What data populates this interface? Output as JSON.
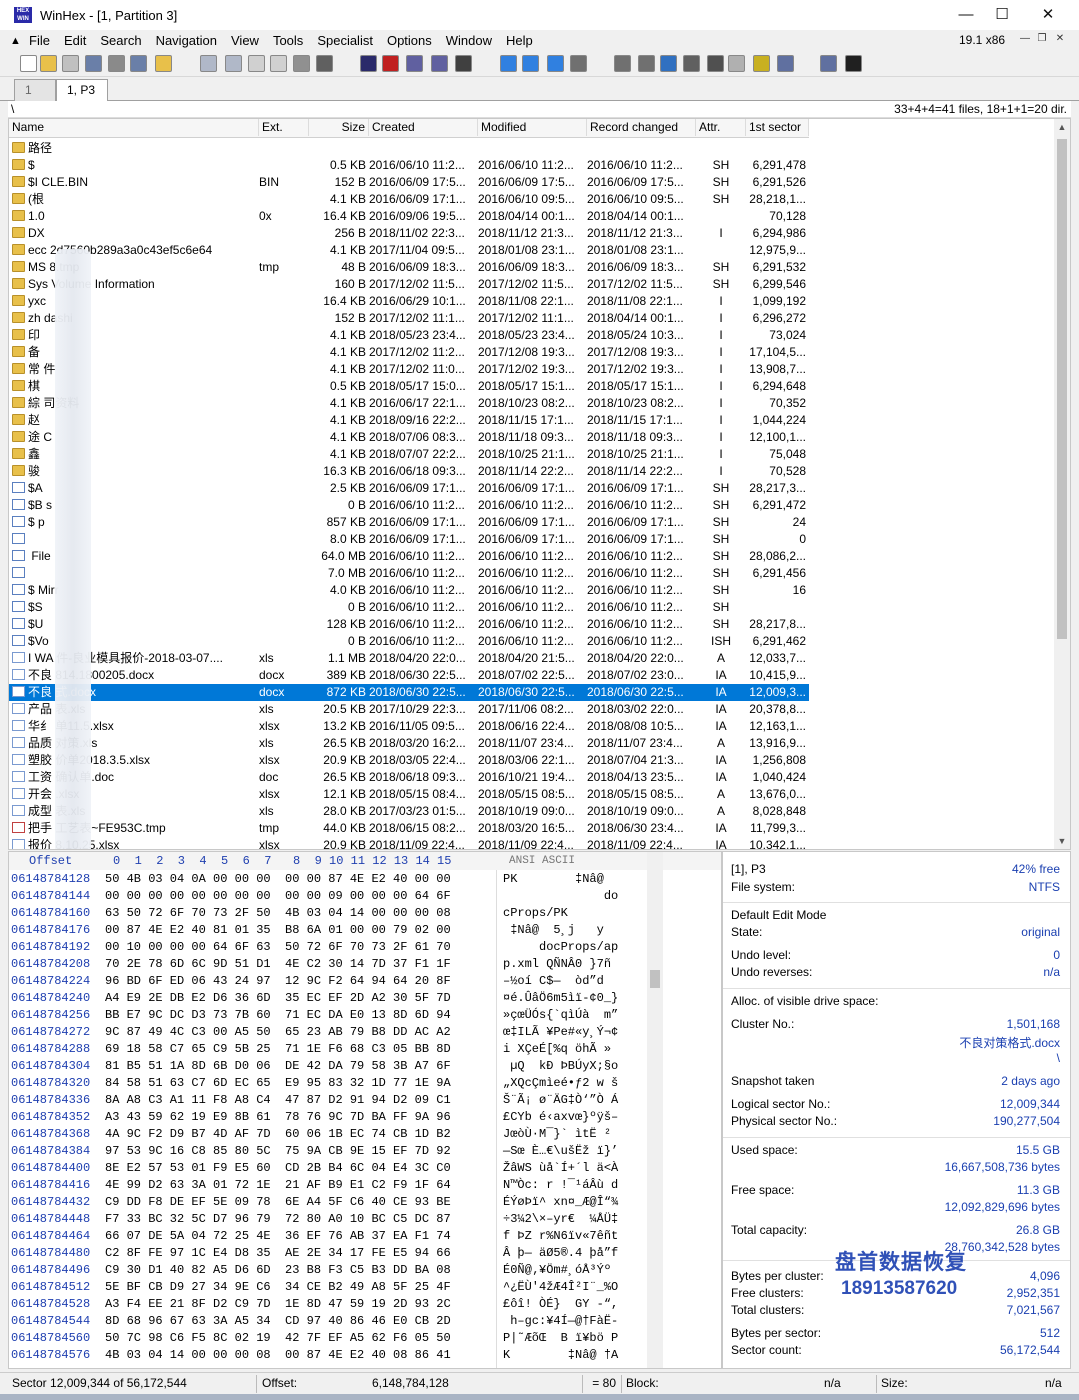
{
  "window": {
    "title": "WinHex - [1, Partition 3]",
    "version": "19.1 x86"
  },
  "menu": [
    "File",
    "Edit",
    "Search",
    "Navigation",
    "View",
    "Tools",
    "Specialist",
    "Options",
    "Window",
    "Help"
  ],
  "tabs": [
    "1",
    "1, P3"
  ],
  "path": {
    "current": "\\",
    "summary": "33+4+4=41 files, 18+1+1=20 dir."
  },
  "columns": [
    "Name",
    "Ext.",
    "Size",
    "Created",
    "Modified",
    "Record changed",
    "Attr.",
    "1st sector"
  ],
  "files": [
    {
      "name": "路径",
      "ext": "",
      "size": "",
      "created": "",
      "modified": "",
      "changed": "",
      "attr": "",
      "sector": "",
      "icon": "folder"
    },
    {
      "name": "$",
      "ext": "",
      "size": "0.5 KB",
      "created": "2016/06/10  11:2...",
      "modified": "2016/06/10  11:2...",
      "changed": "2016/06/10  11:2...",
      "attr": "SH",
      "sector": "6,291,478",
      "icon": "folder"
    },
    {
      "name": "$I     CLE.BIN",
      "ext": "BIN",
      "size": "152 B",
      "created": "2016/06/09  17:5...",
      "modified": "2016/06/09  17:5...",
      "changed": "2016/06/09  17:5...",
      "attr": "SH",
      "sector": "6,291,526",
      "icon": "folder"
    },
    {
      "name": "(根",
      "ext": "",
      "size": "4.1 KB",
      "created": "2016/06/09  17:1...",
      "modified": "2016/06/10  09:5...",
      "changed": "2016/06/10  09:5...",
      "attr": "SH",
      "sector": "28,218,1...",
      "icon": "folder"
    },
    {
      "name": "1.0",
      "ext": "0x",
      "size": "16.4 KB",
      "created": "2016/09/06  19:5...",
      "modified": "2018/04/14  00:1...",
      "changed": "2018/04/14  00:1...",
      "attr": "",
      "sector": "70,128",
      "icon": "folder"
    },
    {
      "name": "DX",
      "ext": "",
      "size": "256 B",
      "created": "2018/11/02  22:3...",
      "modified": "2018/11/12  21:3...",
      "changed": "2018/11/12  21:3...",
      "attr": "I",
      "sector": "6,294,986",
      "icon": "folder"
    },
    {
      "name": "ecc     2d7560b289a3a0c43ef5c6e64",
      "ext": "",
      "size": "4.1 KB",
      "created": "2017/11/04  09:5...",
      "modified": "2018/01/08  23:1...",
      "changed": "2018/01/08  23:1...",
      "attr": "",
      "sector": "12,975,9...",
      "icon": "folder"
    },
    {
      "name": "MS      8.tmp",
      "ext": "tmp",
      "size": "48 B",
      "created": "2016/06/09  18:3...",
      "modified": "2016/06/09  18:3...",
      "changed": "2016/06/09  18:3...",
      "attr": "SH",
      "sector": "6,291,532",
      "icon": "folder"
    },
    {
      "name": "Sys     Volume Information",
      "ext": "",
      "size": "160 B",
      "created": "2017/12/02  11:5...",
      "modified": "2017/12/02  11:5...",
      "changed": "2017/12/02  11:5...",
      "attr": "SH",
      "sector": "6,299,546",
      "icon": "folder"
    },
    {
      "name": "yxc",
      "ext": "",
      "size": "16.4 KB",
      "created": "2016/06/29  10:1...",
      "modified": "2018/11/08  22:1...",
      "changed": "2018/11/08  22:1...",
      "attr": "I",
      "sector": "1,099,192",
      "icon": "folder"
    },
    {
      "name": "zh      dashi",
      "ext": "",
      "size": "152 B",
      "created": "2017/12/02  11:1...",
      "modified": "2017/12/02  11:1...",
      "changed": "2018/04/14  00:1...",
      "attr": "I",
      "sector": "6,296,272",
      "icon": "folder"
    },
    {
      "name": "印",
      "ext": "",
      "size": "4.1 KB",
      "created": "2018/05/23  23:4...",
      "modified": "2018/05/23  23:4...",
      "changed": "2018/05/24  10:3...",
      "attr": "I",
      "sector": "73,024",
      "icon": "folder"
    },
    {
      "name": "备",
      "ext": "",
      "size": "4.1 KB",
      "created": "2017/12/02  11:2...",
      "modified": "2017/12/08  19:3...",
      "changed": "2017/12/08  19:3...",
      "attr": "I",
      "sector": "17,104,5...",
      "icon": "folder"
    },
    {
      "name": "常      件",
      "ext": "",
      "size": "4.1 KB",
      "created": "2017/12/02  11:0...",
      "modified": "2017/12/02  19:3...",
      "changed": "2017/12/02  19:3...",
      "attr": "I",
      "sector": "13,908,7...",
      "icon": "folder"
    },
    {
      "name": "棋",
      "ext": "",
      "size": "0.5 KB",
      "created": "2018/05/17  15:0...",
      "modified": "2018/05/17  15:1...",
      "changed": "2018/05/17  15:1...",
      "attr": "I",
      "sector": "6,294,648",
      "icon": "folder"
    },
    {
      "name": "綜      司资料",
      "ext": "",
      "size": "4.1 KB",
      "created": "2016/06/17  22:1...",
      "modified": "2018/10/23  08:2...",
      "changed": "2018/10/23  08:2...",
      "attr": "I",
      "sector": "70,352",
      "icon": "folder"
    },
    {
      "name": "赵",
      "ext": "",
      "size": "4.1 KB",
      "created": "2018/09/16  22:2...",
      "modified": "2018/11/15  17:1...",
      "changed": "2018/11/15  17:1...",
      "attr": "I",
      "sector": "1,044,224",
      "icon": "folder"
    },
    {
      "name": "途      C",
      "ext": "",
      "size": "4.1 KB",
      "created": "2018/07/06  08:3...",
      "modified": "2018/11/18  09:3...",
      "changed": "2018/11/18  09:3...",
      "attr": "I",
      "sector": "12,100,1...",
      "icon": "folder"
    },
    {
      "name": "鑫",
      "ext": "",
      "size": "4.1 KB",
      "created": "2018/07/07  22:2...",
      "modified": "2018/10/25  21:1...",
      "changed": "2018/10/25  21:1...",
      "attr": "I",
      "sector": "75,048",
      "icon": "folder"
    },
    {
      "name": "骏",
      "ext": "",
      "size": "16.3 KB",
      "created": "2016/06/18  09:3...",
      "modified": "2018/11/14  22:2...",
      "changed": "2018/11/14  22:2...",
      "attr": "I",
      "sector": "70,528",
      "icon": "folder"
    },
    {
      "name": "$A",
      "ext": "",
      "size": "2.5 KB",
      "created": "2016/06/09  17:1...",
      "modified": "2016/06/09  17:1...",
      "changed": "2016/06/09  17:1...",
      "attr": "SH",
      "sector": "28,217,3...",
      "icon": "sys"
    },
    {
      "name": "$B      s",
      "ext": "",
      "size": "0 B",
      "created": "2016/06/10  11:2...",
      "modified": "2016/06/10  11:2...",
      "changed": "2016/06/10  11:2...",
      "attr": "SH",
      "sector": "6,291,472",
      "icon": "sys"
    },
    {
      "name": "$       p",
      "ext": "",
      "size": "857 KB",
      "created": "2016/06/09  17:1...",
      "modified": "2016/06/09  17:1...",
      "changed": "2016/06/09  17:1...",
      "attr": "SH",
      "sector": "24",
      "icon": "sys"
    },
    {
      "name": "",
      "ext": "",
      "size": "8.0 KB",
      "created": "2016/06/09  17:1...",
      "modified": "2016/06/09  17:1...",
      "changed": "2016/06/09  17:1...",
      "attr": "SH",
      "sector": "0",
      "icon": "sys"
    },
    {
      "name": "      File",
      "ext": "",
      "size": "64.0 MB",
      "created": "2016/06/10  11:2...",
      "modified": "2016/06/10  11:2...",
      "changed": "2016/06/10  11:2...",
      "attr": "SH",
      "sector": "28,086,2...",
      "icon": "sys"
    },
    {
      "name": "",
      "ext": "",
      "size": "7.0 MB",
      "created": "2016/06/10  11:2...",
      "modified": "2016/06/10  11:2...",
      "changed": "2016/06/10  11:2...",
      "attr": "SH",
      "sector": "6,291,456",
      "icon": "sys"
    },
    {
      "name": "$       Mirr",
      "ext": "",
      "size": "4.0 KB",
      "created": "2016/06/10  11:2...",
      "modified": "2016/06/10  11:2...",
      "changed": "2016/06/10  11:2...",
      "attr": "SH",
      "sector": "16",
      "icon": "sys"
    },
    {
      "name": "$S",
      "ext": "",
      "size": "0 B",
      "created": "2016/06/10  11:2...",
      "modified": "2016/06/10  11:2...",
      "changed": "2016/06/10  11:2...",
      "attr": "SH",
      "sector": "",
      "icon": "sys"
    },
    {
      "name": "$U",
      "ext": "",
      "size": "128 KB",
      "created": "2016/06/10  11:2...",
      "modified": "2016/06/10  11:2...",
      "changed": "2016/06/10  11:2...",
      "attr": "SH",
      "sector": "28,217,8...",
      "icon": "sys"
    },
    {
      "name": "$Vo",
      "ext": "",
      "size": "0 B",
      "created": "2016/06/10  11:2...",
      "modified": "2016/06/10  11:2...",
      "changed": "2016/06/10  11:2...",
      "attr": "ISH",
      "sector": "6,291,462",
      "icon": "sys"
    },
    {
      "name": "I WA      件-良业模具报价-2018-03-07....",
      "ext": "xls",
      "size": "1.1 MB",
      "created": "2018/04/20  22:0...",
      "modified": "2018/04/20  21:5...",
      "changed": "2018/04/20  22:0...",
      "attr": "A",
      "sector": "12,033,7...",
      "icon": "doc"
    },
    {
      "name": "不良      814.1800205.docx",
      "ext": "docx",
      "size": "389 KB",
      "created": "2018/06/30  22:5...",
      "modified": "2018/07/02  22:5...",
      "changed": "2018/07/02  23:0...",
      "attr": "IA",
      "sector": "10,415,9...",
      "icon": "doc"
    },
    {
      "name": "不良      式.docx",
      "ext": "docx",
      "size": "872 KB",
      "created": "2018/06/30  22:5...",
      "modified": "2018/06/30  22:5...",
      "changed": "2018/06/30  22:5...",
      "attr": "IA",
      "sector": "12,009,3...",
      "icon": "doc",
      "selected": true
    },
    {
      "name": "产品      表.xls",
      "ext": "xls",
      "size": "20.5 KB",
      "created": "2017/10/29  22:3...",
      "modified": "2017/11/06  08:2...",
      "changed": "2018/03/02  22:0...",
      "attr": "IA",
      "sector": "20,378,8...",
      "icon": "doc"
    },
    {
      "name": "华纟      单11.5.xlsx",
      "ext": "xlsx",
      "size": "13.2 KB",
      "created": "2016/11/05  09:5...",
      "modified": "2018/06/16  22:4...",
      "changed": "2018/08/08  10:5...",
      "attr": "IA",
      "sector": "12,163,1...",
      "icon": "doc"
    },
    {
      "name": "品质      对策.xls",
      "ext": "xls",
      "size": "26.5 KB",
      "created": "2018/03/20  16:2...",
      "modified": "2018/11/07  23:4...",
      "changed": "2018/11/07  23:4...",
      "attr": "A",
      "sector": "13,916,9...",
      "icon": "doc"
    },
    {
      "name": "塑胶      价单2018.3.5.xlsx",
      "ext": "xlsx",
      "size": "20.9 KB",
      "created": "2018/03/05  22:4...",
      "modified": "2018/03/06  22:1...",
      "changed": "2018/07/04  21:3...",
      "attr": "IA",
      "sector": "1,256,808",
      "icon": "doc"
    },
    {
      "name": "工资      确认单.doc",
      "ext": "doc",
      "size": "26.5 KB",
      "created": "2018/06/18  09:3...",
      "modified": "2016/10/21  19:4...",
      "changed": "2018/04/13  23:5...",
      "attr": "IA",
      "sector": "1,040,424",
      "icon": "doc"
    },
    {
      "name": "开会      .xlsx",
      "ext": "xlsx",
      "size": "12.1 KB",
      "created": "2018/05/15  08:4...",
      "modified": "2018/05/15  08:5...",
      "changed": "2018/05/15  08:5...",
      "attr": "A",
      "sector": "13,676,0...",
      "icon": "doc"
    },
    {
      "name": "成型      表.xls",
      "ext": "xls",
      "size": "28.0 KB",
      "created": "2017/03/23  01:5...",
      "modified": "2018/10/19  09:0...",
      "changed": "2018/10/19  09:0...",
      "attr": "A",
      "sector": "8,028,848",
      "icon": "doc"
    },
    {
      "name": "把手      工艺表~FE953C.tmp",
      "ext": "tmp",
      "size": "44.0 KB",
      "created": "2018/06/15  08:2...",
      "modified": "2018/03/20  16:5...",
      "changed": "2018/06/30  23:4...",
      "attr": "IA",
      "sector": "11,799,3...",
      "icon": "del"
    },
    {
      "name": "报价      8.10.25.xlsx",
      "ext": "xlsx",
      "size": "20.9 KB",
      "created": "2018/11/09  22:4...",
      "modified": "2018/11/09  22:4...",
      "changed": "2018/11/09  22:4...",
      "attr": "IA",
      "sector": "10,342,1...",
      "icon": "doc"
    }
  ],
  "hex": {
    "header_offset": "Offset",
    "header_cols": "0  1  2  3  4  5  6  7   8  9 10 11 12 13 14 15",
    "header_text": "ANSI ASCII",
    "rows": [
      [
        "06148784128",
        "50 4B 03 04 0A 00 00 00  00 00 87 4E E2 40 00 00",
        "PK        ‡Nâ@  "
      ],
      [
        "06148784144",
        "00 00 00 00 00 00 00 00  00 00 09 00 00 00 64 6F",
        "              do"
      ],
      [
        "06148784160",
        "63 50 72 6F 70 73 2F 50  4B 03 04 14 00 00 00 08",
        "cProps/PK       "
      ],
      [
        "06148784176",
        "00 87 4E E2 40 81 01 35  B8 6A 01 00 00 79 02 00",
        " ‡Nâ@  5¸j   y  "
      ],
      [
        "06148784192",
        "00 10 00 00 00 64 6F 63  50 72 6F 70 73 2F 61 70",
        "     docProps/ap"
      ],
      [
        "06148784208",
        "70 2E 78 6D 6C 9D 51 D1  4E C2 30 14 7D 37 F1 1F",
        "p.xml QÑNÂ0 }7ñ "
      ],
      [
        "06148784224",
        "96 BD 6F ED 06 43 24 97  12 9C F2 64 94 64 20 8F",
        "–½oí C$—  òd”d  "
      ],
      [
        "06148784240",
        "A4 E9 2E DB E2 D6 36 6D  35 EC EF 2D A2 30 5F 7D",
        "¤é.ÛâÖ6m5ìï-¢0_}"
      ],
      [
        "06148784256",
        "BB E7 9C DC D3 73 7B 60  71 EC DA E0 13 8D 6D 94",
        "»çœÜÓs{`qìÚà  m”"
      ],
      [
        "06148784272",
        "9C 87 49 4C C3 00 A5 50  65 23 AB 79 B8 DD AC A2",
        "œ‡ILÃ ¥Pe#«y¸Ý¬¢"
      ],
      [
        "06148784288",
        "69 18 58 C7 65 C9 5B 25  71 1E F6 68 C3 05 BB 8D",
        "i XÇeÉ[%q öhÃ » "
      ],
      [
        "06148784304",
        "81 B5 51 1A 8D 6B D0 06  DE 42 DA 79 58 3B A7 6F",
        " µQ  kÐ ÞBÚyX;§o"
      ],
      [
        "06148784320",
        "84 58 51 63 C7 6D EC 65  E9 95 83 32 1D 77 1E 9A",
        "„XQcÇmìeé•ƒ2 w š"
      ],
      [
        "06148784336",
        "8A A8 C3 A1 11 F8 A8 C4  47 87 D2 91 94 D2 09 C1",
        "Š¨Ã¡ ø¨ÄG‡Ò‘”Ò Á"
      ],
      [
        "06148784352",
        "A3 43 59 62 19 E9 8B 61  78 76 9C 7D BA FF 9A 96",
        "£CYb é‹axvœ}ºÿš–"
      ],
      [
        "06148784368",
        "4A 9C F2 D9 B7 4D AF 7D  60 06 1B EC 74 CB 1D B2",
        "JœòÙ·M¯}` ìtË ²"
      ],
      [
        "06148784384",
        "97 53 9C 16 C8 85 80 5C  75 9A CB 9E 15 EF 7D 92",
        "—Sœ È…€\\ušËž ï}’"
      ],
      [
        "06148784400",
        "8E E2 57 53 01 F9 E5 60  CD 2B B4 6C 04 E4 3C C0",
        "ŽâWS ùå`Í+´l ä<À"
      ],
      [
        "06148784416",
        "4E 99 D2 63 3A 01 72 1E  21 AF B9 E1 C2 F9 1F 64",
        "N™Òc: r !¯¹áÂù d"
      ],
      [
        "06148784432",
        "C9 DD F8 DE EF 5E 09 78  6E A4 5F C6 40 CE 93 BE",
        "ÉÝøÞï^ xn¤_Æ@Î“¾"
      ],
      [
        "06148784448",
        "F7 33 BC 32 5C D7 96 79  72 80 A0 10 BC C5 DC 87",
        "÷3¼2\\×–yr€  ¼ÅÜ‡"
      ],
      [
        "06148784464",
        "66 07 DE 5A 04 72 25 4E  36 EF 76 AB 37 EA F1 74",
        "f ÞZ r%N6ïv«7êñt"
      ],
      [
        "06148784480",
        "C2 8F FE 97 1C E4 D8 35  AE 2E 34 17 FE E5 94 66",
        "Â þ— äØ5®.4 þå”f"
      ],
      [
        "06148784496",
        "C9 30 D1 40 82 A5 D6 6D  23 B8 F3 C5 B3 DD BA 08",
        "É0Ñ@‚¥Öm#¸óÅ³Ýº "
      ],
      [
        "06148784512",
        "5E BF CB D9 27 34 9E C6  34 CE B2 49 A8 5F 25 4F",
        "^¿ËÙ'4žÆ4Î²I¨_%O"
      ],
      [
        "06148784528",
        "A3 F4 EE 21 8F D2 C9 7D  1E 8D 47 59 19 2D 93 2C",
        "£ôî! ÒÉ}  GY -“,"
      ],
      [
        "06148784544",
        "8D 68 96 67 63 3A A5 34  CD 97 40 86 46 E0 CB 2D",
        " h–gc:¥4Í—@†FàË-"
      ],
      [
        "06148784560",
        "50 7C 98 C6 F5 8C 02 19  42 7F EF A5 62 F6 05 50",
        "P|˜ÆõŒ  B ï¥bö P"
      ],
      [
        "06148784576",
        "4B 03 04 14 00 00 00 08  00 87 4E E2 40 08 86 41",
        "K        ‡Nâ@ †A"
      ]
    ]
  },
  "info": {
    "partition": "[1], P3",
    "free_pct": "42% free",
    "fs_label": "File system:",
    "fs_value": "NTFS",
    "edit_mode_label": "Default Edit Mode",
    "state_label": "State:",
    "state_value": "original",
    "undo_level_label": "Undo level:",
    "undo_level_value": "0",
    "undo_rev_label": "Undo reverses:",
    "undo_rev_value": "n/a",
    "alloc_label": "Alloc. of visible drive space:",
    "cluster_label": "Cluster No.:",
    "cluster_value": "1,501,168",
    "cluster_file": "不良对策格式.docx",
    "cluster_path": "\\",
    "snapshot_label": "Snapshot taken",
    "snapshot_value": "2 days ago",
    "logical_label": "Logical sector No.:",
    "logical_value": "12,009,344",
    "physical_label": "Physical sector No.:",
    "physical_value": "190,277,504",
    "used_label": "Used space:",
    "used_gb": "15.5 GB",
    "used_bytes": "16,667,508,736 bytes",
    "free_label": "Free space:",
    "free_gb": "11.3 GB",
    "free_bytes": "12,092,829,696 bytes",
    "total_label": "Total capacity:",
    "total_gb": "26.8 GB",
    "total_bytes": "28,760,342,528 bytes",
    "bpc_label": "Bytes per cluster:",
    "bpc_value": "4,096",
    "fc_label": "Free clusters:",
    "fc_value": "2,952,351",
    "tc_label": "Total clusters:",
    "tc_value": "7,021,567",
    "bps_label": "Bytes per sector:",
    "bps_value": "512",
    "sc_label": "Sector count:",
    "sc_value": "56,172,544"
  },
  "watermark": {
    "line1": "盘首数据恢复",
    "line2": "18913587620"
  },
  "status": {
    "sector": "Sector 12,009,344 of 56,172,544",
    "offset_label": "Offset:",
    "offset_value": "6,148,784,128",
    "eq": "= 80",
    "block_label": "Block:",
    "block_value": "n/a",
    "size_label": "Size:",
    "size_value": "n/a"
  },
  "colors": {
    "selection": "#0078d7",
    "offset_blue": "#2040b0",
    "folder": "#e8c04a"
  }
}
